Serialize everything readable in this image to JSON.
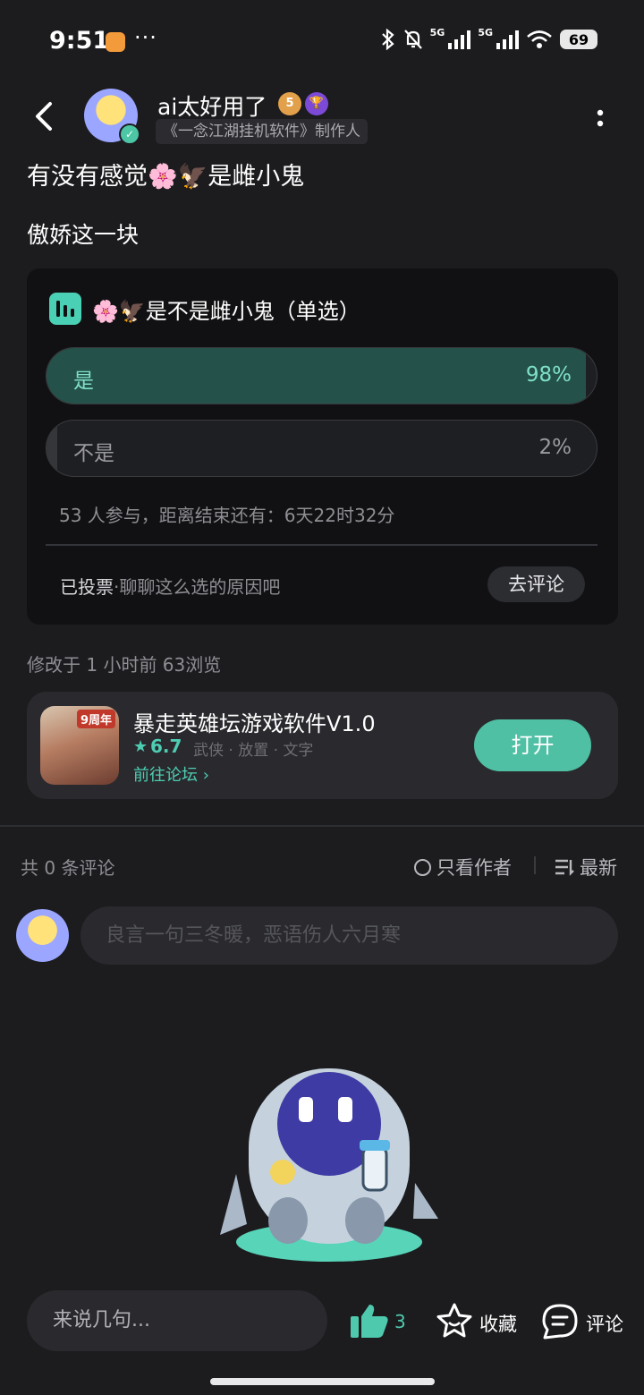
{
  "status_bar": {
    "time": "9:51",
    "dots": "···",
    "network_label": "5G",
    "battery": "69"
  },
  "author": {
    "name": "ai太好用了",
    "level_badge": "5",
    "role": "《一念江湖挂机软件》制作人"
  },
  "post": {
    "title": "有没有感觉🌸🦅是雌小鬼",
    "body": "傲娇这一块",
    "meta": "修改于 1 小时前  63浏览"
  },
  "poll": {
    "title": "🌸🦅是不是雌小鬼（单选）",
    "options": [
      {
        "label": "是",
        "percent_text": "98%",
        "percent": 98,
        "selected": true
      },
      {
        "label": "不是",
        "percent_text": "2%",
        "percent": 2,
        "selected": false
      }
    ],
    "meta": "53 人参与，距离结束还有：6天22时32分",
    "voted_label": "已投票",
    "voted_hint": "·聊聊这么选的原因吧",
    "comment_button": "去评论"
  },
  "game": {
    "icon_tag": "9周年",
    "name": "暴走英雄坛游戏软件V1.0",
    "rating": "6.7",
    "tags": "武侠 · 放置 · 文字",
    "forum_link": "前往论坛",
    "open_button": "打开"
  },
  "comments": {
    "count_label": "共 0 条评论",
    "author_only": "只看作者",
    "sort": "最新",
    "input_placeholder": "良言一句三冬暖，恶语伤人六月寒"
  },
  "bottom_bar": {
    "say_placeholder": "来说几句...",
    "like_count": "3",
    "favorite": "收藏",
    "comment": "评论"
  },
  "colors": {
    "background": "#1c1c1f",
    "accent": "#4fc0a4",
    "poll_fill": "#24524a"
  }
}
